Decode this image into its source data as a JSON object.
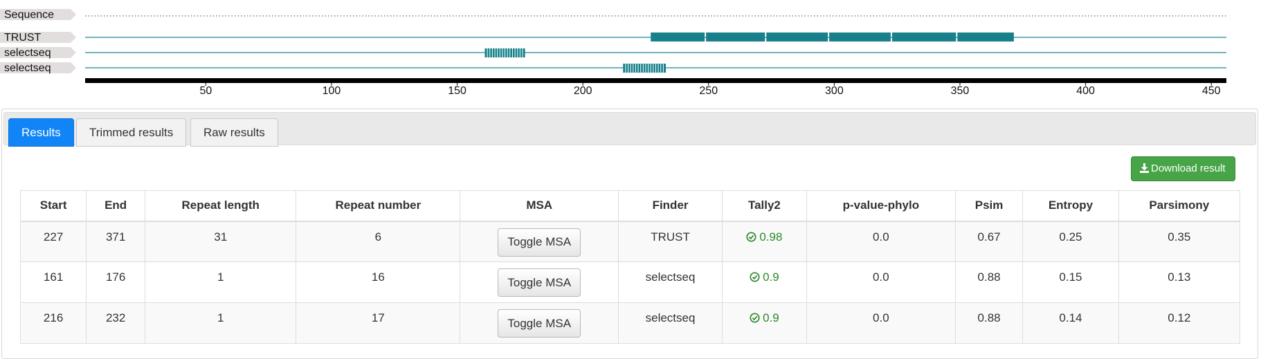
{
  "viewer": {
    "axis": {
      "min": 2,
      "max": 456,
      "ticks": [
        50,
        100,
        150,
        200,
        250,
        300,
        350,
        400,
        450
      ]
    },
    "tracks": [
      {
        "label": "Sequence",
        "style": "dotted",
        "features": []
      },
      {
        "label": "TRUST",
        "style": "line",
        "features": [
          {
            "type": "block",
            "start": 227,
            "end": 248
          },
          {
            "type": "block",
            "start": 249,
            "end": 272
          },
          {
            "type": "block",
            "start": 273,
            "end": 297
          },
          {
            "type": "block",
            "start": 298,
            "end": 322
          },
          {
            "type": "block",
            "start": 323,
            "end": 348
          },
          {
            "type": "block",
            "start": 349,
            "end": 371
          }
        ]
      },
      {
        "label": "selectseq",
        "style": "line",
        "features": [
          {
            "type": "stripes",
            "start": 161,
            "end": 176,
            "count": 16
          }
        ]
      },
      {
        "label": "selectseq",
        "style": "line",
        "features": [
          {
            "type": "stripes",
            "start": 216,
            "end": 232,
            "count": 17
          }
        ]
      }
    ],
    "colors": {
      "track": "#1a8690",
      "feature": "#17808a",
      "label_bg": "#e3dede",
      "axis": "#000000"
    }
  },
  "tabs": [
    {
      "label": "Results",
      "active": true
    },
    {
      "label": "Trimmed results",
      "active": false
    },
    {
      "label": "Raw results",
      "active": false
    }
  ],
  "download": {
    "label": "Download result",
    "icon": "download-icon"
  },
  "table": {
    "headers": [
      "Start",
      "End",
      "Repeat length",
      "Repeat number",
      "MSA",
      "Finder",
      "Tally2",
      "p-value-phylo",
      "Psim",
      "Entropy",
      "Parsimony"
    ],
    "rows": [
      {
        "start": "227",
        "end": "371",
        "repeat_length": "31",
        "repeat_number": "6",
        "msa": "Toggle MSA",
        "finder": "TRUST",
        "tally2": "0.98",
        "pvalue": "0.0",
        "psim": "0.67",
        "entropy": "0.25",
        "parsimony": "0.35"
      },
      {
        "start": "161",
        "end": "176",
        "repeat_length": "1",
        "repeat_number": "16",
        "msa": "Toggle MSA",
        "finder": "selectseq",
        "tally2": "0.9",
        "pvalue": "0.0",
        "psim": "0.88",
        "entropy": "0.15",
        "parsimony": "0.13"
      },
      {
        "start": "216",
        "end": "232",
        "repeat_length": "1",
        "repeat_number": "17",
        "msa": "Toggle MSA",
        "finder": "selectseq",
        "tally2": "0.9",
        "pvalue": "0.0",
        "psim": "0.88",
        "entropy": "0.14",
        "parsimony": "0.12"
      }
    ],
    "tally_icon": "check-circle-icon",
    "tally_color": "#2b8a2b"
  }
}
